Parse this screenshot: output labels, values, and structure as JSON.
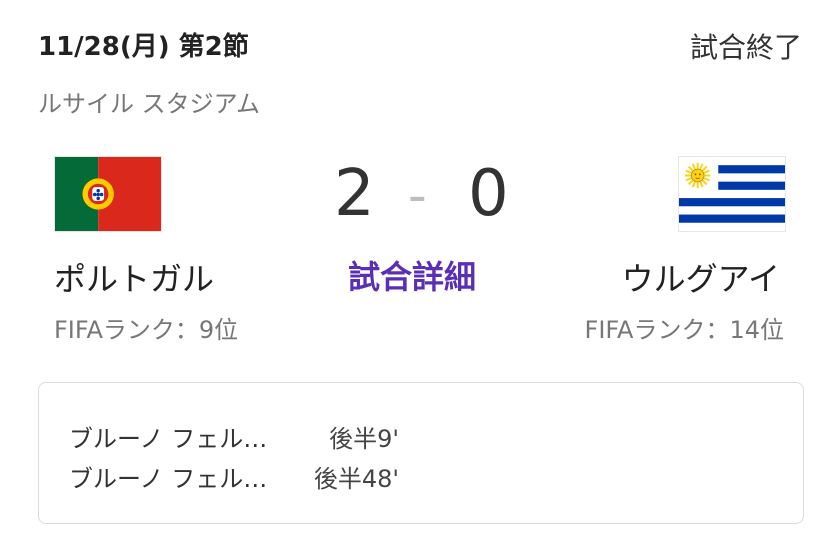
{
  "match": {
    "date": "11/28(月) 第2節",
    "status": "試合終了",
    "venue": "ルサイル スタジアム",
    "detail_label": "試合詳細",
    "score_separator": "-"
  },
  "home": {
    "name": "ポルトガル",
    "score": "2",
    "rank": "FIFAランク：9位",
    "flag_icon": "portugal-flag-icon",
    "colors": {
      "green": "#046a38",
      "red": "#da291c",
      "yellow": "#ffcc00"
    }
  },
  "away": {
    "name": "ウルグアイ",
    "score": "0",
    "rank": "FIFAランク：14位",
    "flag_icon": "uruguay-flag-icon",
    "colors": {
      "blue": "#0038a8",
      "white": "#ffffff",
      "sun": "#fcd116"
    }
  },
  "goals": [
    {
      "player": "ブルーノ フェル…",
      "time": "後半9'"
    },
    {
      "player": "ブルーノ フェル…",
      "time": "後半48'"
    }
  ],
  "accent_color": "#5b2fb5"
}
